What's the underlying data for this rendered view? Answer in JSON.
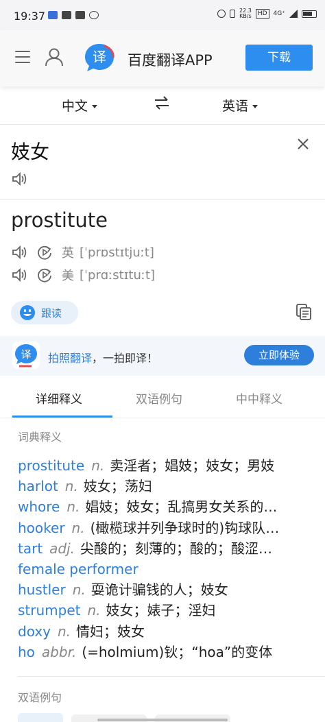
{
  "status_bar": {
    "time": "19:37",
    "network_speed": "22.3\nKB/s",
    "hd": "HD",
    "signal": "4G⁺"
  },
  "header": {
    "app_name": "百度翻译APP",
    "download_label": "下载",
    "logo_char": "译"
  },
  "language": {
    "source": "中文",
    "target": "英语"
  },
  "source": {
    "text": "妓女"
  },
  "result": {
    "word": "prostitute",
    "uk_label": "英",
    "uk_phonetic": "[ˈprɒstɪtjuːt]",
    "us_label": "美",
    "us_phonetic": "[ˈprɑːstɪtuːt]",
    "follow_read_label": "跟读"
  },
  "promo": {
    "highlight": "拍照翻译",
    "text": "，一拍即译！",
    "button_label": "立即体验",
    "logo_char": "译"
  },
  "tabs": [
    {
      "label": "详细释义",
      "active": true
    },
    {
      "label": "双语例句",
      "active": false
    },
    {
      "label": "中中释义",
      "active": false
    }
  ],
  "dictionary": {
    "title": "词典释义",
    "entries": [
      {
        "word": "prostitute",
        "pos": "n.",
        "def": "卖淫者；娼妓；妓女；男妓"
      },
      {
        "word": "harlot",
        "pos": "n.",
        "def": "妓女；荡妇"
      },
      {
        "word": "whore",
        "pos": "n.",
        "def": "娼妓；妓女；乱搞男女关系的…"
      },
      {
        "word": "hooker",
        "pos": "n.",
        "def": "(橄榄球并列争球时的)钩球队…"
      },
      {
        "word": "tart",
        "pos": "adj.",
        "def": "尖酸的；刻薄的；酸的；酸涩…"
      },
      {
        "word": "female performer",
        "pos": "",
        "def": ""
      },
      {
        "word": "hustler",
        "pos": "n.",
        "def": "耍诡计骗钱的人；妓女"
      },
      {
        "word": "strumpet",
        "pos": "n.",
        "def": "妓女；婊子；淫妇"
      },
      {
        "word": "doxy",
        "pos": "n.",
        "def": "情妇；妓女"
      },
      {
        "word": "ho",
        "pos": "abbr.",
        "def": "(=holmium)钬；“hoa”的变体"
      }
    ]
  },
  "bilingual": {
    "title": "双语例句"
  },
  "colors": {
    "accent": "#2e8ef0",
    "link": "#2e7fdc",
    "muted": "#888888"
  }
}
